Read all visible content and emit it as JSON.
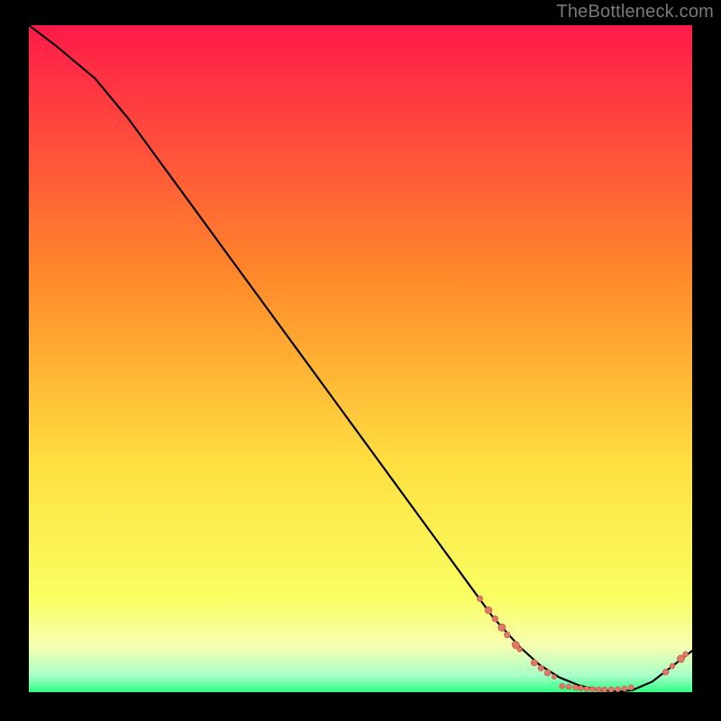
{
  "watermark": "TheBottleneck.com",
  "colors": {
    "brand_text": "#7a7a7a",
    "gradient_top": "#ff1a4a",
    "gradient_mid_orange": "#ff8a2a",
    "gradient_mid_yellow": "#ffe040",
    "gradient_pale": "#f7ffb0",
    "gradient_green": "#2eff82",
    "curve": "#000000",
    "marker_fill": "#e07868",
    "marker_stroke": "#c05a4a"
  },
  "chart_data": {
    "type": "line",
    "title": "",
    "xlabel": "",
    "ylabel": "",
    "xlim": [
      0,
      100
    ],
    "ylim": [
      0,
      100
    ],
    "curve": {
      "x": [
        0,
        4,
        7,
        10,
        15,
        20,
        25,
        30,
        35,
        40,
        45,
        50,
        55,
        60,
        65,
        70,
        74,
        77,
        80,
        83,
        86,
        89,
        91,
        94,
        100
      ],
      "y": [
        100,
        97,
        94.5,
        92,
        86,
        79.2,
        72.4,
        65.6,
        58.8,
        52,
        45.2,
        38.4,
        31.6,
        24.8,
        18,
        11.2,
        6.8,
        4.1,
        2.2,
        1.0,
        0.3,
        0.1,
        0.3,
        1.6,
        6.2
      ]
    },
    "markers": [
      {
        "x": 68.0,
        "y": 14.0,
        "r": 3.2
      },
      {
        "x": 69.3,
        "y": 12.3,
        "r": 4.0
      },
      {
        "x": 70.3,
        "y": 11.0,
        "r": 3.4
      },
      {
        "x": 71.3,
        "y": 9.7,
        "r": 4.2
      },
      {
        "x": 72.1,
        "y": 8.6,
        "r": 3.4
      },
      {
        "x": 73.4,
        "y": 7.1,
        "r": 4.2
      },
      {
        "x": 74.0,
        "y": 6.4,
        "r": 2.8
      },
      {
        "x": 76.2,
        "y": 4.4,
        "r": 3.6
      },
      {
        "x": 77.2,
        "y": 3.6,
        "r": 3.2
      },
      {
        "x": 78.2,
        "y": 2.9,
        "r": 3.6
      },
      {
        "x": 79.2,
        "y": 2.3,
        "r": 2.6
      },
      {
        "x": 80.4,
        "y": 0.9,
        "r": 3.0
      },
      {
        "x": 81.4,
        "y": 0.8,
        "r": 3.0
      },
      {
        "x": 82.4,
        "y": 0.7,
        "r": 3.0
      },
      {
        "x": 83.2,
        "y": 0.6,
        "r": 3.0
      },
      {
        "x": 84.1,
        "y": 0.5,
        "r": 3.0
      },
      {
        "x": 85.0,
        "y": 0.45,
        "r": 3.0
      },
      {
        "x": 85.9,
        "y": 0.4,
        "r": 3.0
      },
      {
        "x": 86.8,
        "y": 0.4,
        "r": 3.0
      },
      {
        "x": 87.8,
        "y": 0.4,
        "r": 3.0
      },
      {
        "x": 88.8,
        "y": 0.45,
        "r": 3.0
      },
      {
        "x": 89.8,
        "y": 0.55,
        "r": 3.0
      },
      {
        "x": 90.8,
        "y": 0.7,
        "r": 3.0
      },
      {
        "x": 96.0,
        "y": 3.0,
        "r": 3.4
      },
      {
        "x": 97.0,
        "y": 3.9,
        "r": 3.0
      },
      {
        "x": 98.3,
        "y": 5.0,
        "r": 4.2
      },
      {
        "x": 99.0,
        "y": 5.7,
        "r": 3.0
      }
    ]
  }
}
